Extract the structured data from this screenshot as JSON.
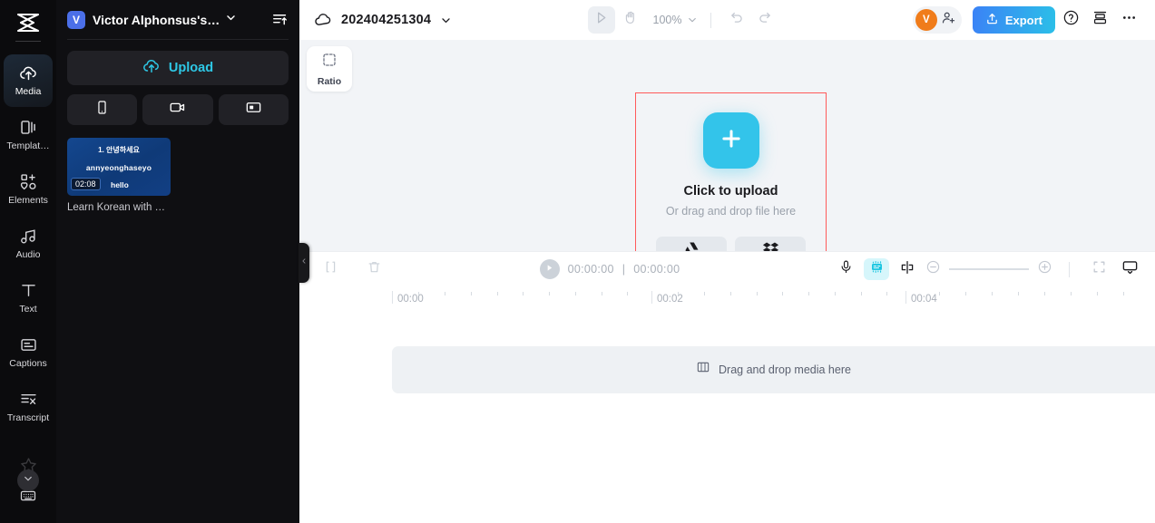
{
  "rail": {
    "logo_icon": "capcut-logo-icon",
    "items": [
      {
        "id": "media",
        "label": "Media",
        "icon": "cloud-upload-icon",
        "active": true
      },
      {
        "id": "templates",
        "label": "Templat…",
        "icon": "templates-icon",
        "active": false
      },
      {
        "id": "elements",
        "label": "Elements",
        "icon": "elements-icon",
        "active": false
      },
      {
        "id": "audio",
        "label": "Audio",
        "icon": "music-note-icon",
        "active": false
      },
      {
        "id": "text",
        "label": "Text",
        "icon": "text-t-icon",
        "active": false
      },
      {
        "id": "captions",
        "label": "Captions",
        "icon": "captions-icon",
        "active": false
      },
      {
        "id": "transcript",
        "label": "Transcript",
        "icon": "transcript-icon",
        "active": false
      }
    ],
    "star_icon": "star-icon",
    "expand_icon": "chevron-down-icon",
    "keyboard_icon": "keyboard-icon"
  },
  "panel": {
    "badge": "V",
    "project_name": "Victor Alphonsus's…",
    "chevron_icon": "chevron-down-icon",
    "sort_icon": "sort-ascending-icon",
    "upload_label": "Upload",
    "upload_icon": "cloud-upload-icon",
    "quick_buttons": [
      {
        "id": "phone",
        "icon": "phone-icon"
      },
      {
        "id": "camera",
        "icon": "video-camera-icon"
      },
      {
        "id": "screen",
        "icon": "screen-record-icon"
      }
    ],
    "media": {
      "line1": "1. 안녕하세요",
      "line2": "annyeonghaseyo",
      "duration": "02:08",
      "overlay_text": "hello",
      "caption": "Learn Korean with …"
    },
    "collapse_icon": "chevron-left-icon"
  },
  "topbar": {
    "cloud_icon": "cloud-icon",
    "doc_title": "202404251304",
    "doc_chevron_icon": "chevron-down-icon",
    "select_tool_icon": "cursor-play-icon",
    "hand_tool_icon": "hand-icon",
    "zoom_level": "100%",
    "zoom_chevron_icon": "chevron-down-icon",
    "undo_icon": "undo-icon",
    "redo_icon": "redo-icon",
    "avatar_initial": "V",
    "avatar_color": "#f07c1a",
    "invite_icon": "add-person-icon",
    "export_label": "Export",
    "export_icon": "upload-share-icon",
    "export_gradient_from": "#3b82f6",
    "export_gradient_to": "#2bbfe8",
    "help_icon": "question-circle-icon",
    "layers_icon": "print-layers-icon",
    "more_icon": "more-horizontal-icon"
  },
  "canvas": {
    "ratio_label": "Ratio",
    "ratio_icon": "dashed-square-icon",
    "dropzone": {
      "plus_icon": "plus-icon",
      "plus_color": "#33c4ea",
      "border_color": "#ff5a5a",
      "title": "Click to upload",
      "subtitle": "Or drag and drop file here",
      "buttons": [
        {
          "id": "google-drive",
          "icon": "google-drive-icon"
        },
        {
          "id": "dropbox",
          "icon": "dropbox-icon"
        }
      ]
    }
  },
  "timeline": {
    "split_icon": "split-clip-icon",
    "delete_icon": "trash-icon",
    "play_icon": "play-icon",
    "current_time": "00:00:00",
    "time_separator": "|",
    "total_time": "00:00:00",
    "mic_icon": "microphone-icon",
    "autocaption_icon": "auto-captions-icon",
    "autocaption_color": "#d6f6fb",
    "mirror_icon": "mirror-split-icon",
    "zoom_out_icon": "minus-circle-icon",
    "zoom_in_icon": "plus-circle-icon",
    "fit_icon": "fit-screen-icon",
    "monitor_icon": "monitor-icon",
    "ruler_labels": [
      "00:00",
      "00:02",
      "00:04"
    ],
    "drop_strip_label": "Drag and drop media here",
    "drop_strip_icon": "film-strip-icon"
  }
}
